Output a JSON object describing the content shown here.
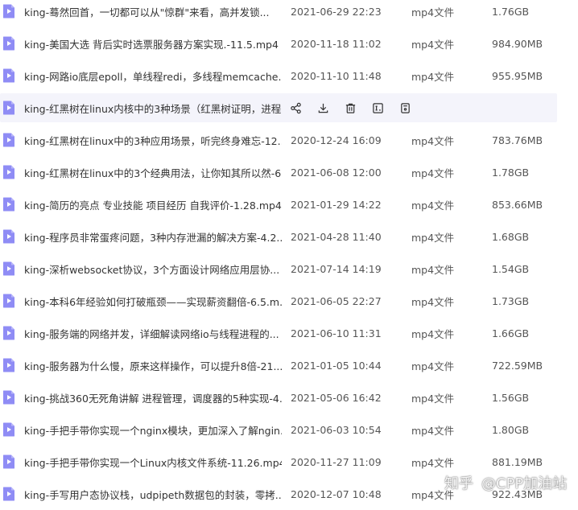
{
  "files": [
    {
      "name": "king-蓦然回首，一切都可以从\"惊群\"来看，高并发锁...",
      "date": "2021-06-29 22:23",
      "type": "mp4文件",
      "size": "1.76GB"
    },
    {
      "name": "king-美国大选 背后实时选票服务器方案实现.-11.5.mp4",
      "date": "2020-11-18 11:02",
      "type": "mp4文件",
      "size": "984.90MB"
    },
    {
      "name": "king-网路io底层epoll，单线程redi，多线程memcache...",
      "date": "2020-11-10 11:48",
      "type": "mp4文件",
      "size": "955.95MB"
    },
    {
      "name": "king-红黑树在linux内核中的3种场景（红黑树证明，进程...",
      "date": "",
      "type": "",
      "size": "",
      "hovered": true
    },
    {
      "name": "king-红黑树在linux中的3种应用场景，听完终身难忘-12....",
      "date": "2020-12-24 16:09",
      "type": "mp4文件",
      "size": "783.76MB"
    },
    {
      "name": "king-红黑树在linux中的3个经典用法，让你知其所以然-6...",
      "date": "2021-06-08 12:00",
      "type": "mp4文件",
      "size": "1.78GB"
    },
    {
      "name": "king-简历的亮点 专业技能 项目经历 自我评价-1.28.mp4",
      "date": "2021-01-29 14:22",
      "type": "mp4文件",
      "size": "853.66MB"
    },
    {
      "name": "king-程序员非常蛋疼问题，3种内存泄漏的解决方案-4.2...",
      "date": "2021-04-28 11:40",
      "type": "mp4文件",
      "size": "1.68GB"
    },
    {
      "name": "king-深析websocket协议，3个方面设计网络应用层协...",
      "date": "2021-07-14 14:19",
      "type": "mp4文件",
      "size": "1.54GB"
    },
    {
      "name": "king-本科6年经验如何打破瓶颈——实现薪资翻倍-6.5.m...",
      "date": "2021-06-05 22:27",
      "type": "mp4文件",
      "size": "1.73GB"
    },
    {
      "name": "king-服务端的网络并发，详细解读网络io与线程进程的...",
      "date": "2021-06-10 11:31",
      "type": "mp4文件",
      "size": "1.66GB"
    },
    {
      "name": "king-服务器为什么慢，原来这样操作，可以提升8倍-21....",
      "date": "2021-01-05 10:44",
      "type": "mp4文件",
      "size": "722.59MB"
    },
    {
      "name": "king-挑战360无死角讲解 进程管理，调度器的5种实现-4...",
      "date": "2021-05-06 16:42",
      "type": "mp4文件",
      "size": "1.56GB"
    },
    {
      "name": "king-手把手带你实现一个nginx模块，更加深入了解ngin...",
      "date": "2021-06-03 10:54",
      "type": "mp4文件",
      "size": "1.80GB"
    },
    {
      "name": "king-手把手带你实现一个Linux内核文件系统-11.26.mp4",
      "date": "2020-11-27 11:09",
      "type": "mp4文件",
      "size": "881.19MB"
    },
    {
      "name": "king-手写用户态协议栈，udpipeth数据包的封装，零拷...",
      "date": "2020-12-07 10:48",
      "type": "mp4文件",
      "size": "922.43MB"
    }
  ],
  "row_actions": [
    {
      "icon": "share-icon"
    },
    {
      "icon": "download-icon"
    },
    {
      "icon": "delete-icon"
    },
    {
      "icon": "rename-icon"
    },
    {
      "icon": "more-icon"
    }
  ],
  "watermark": {
    "site": "知乎",
    "author": "@CPP加油站"
  },
  "colors": {
    "file_icon": "#8f8cf5",
    "hover_bg": "#f4f4fb"
  }
}
